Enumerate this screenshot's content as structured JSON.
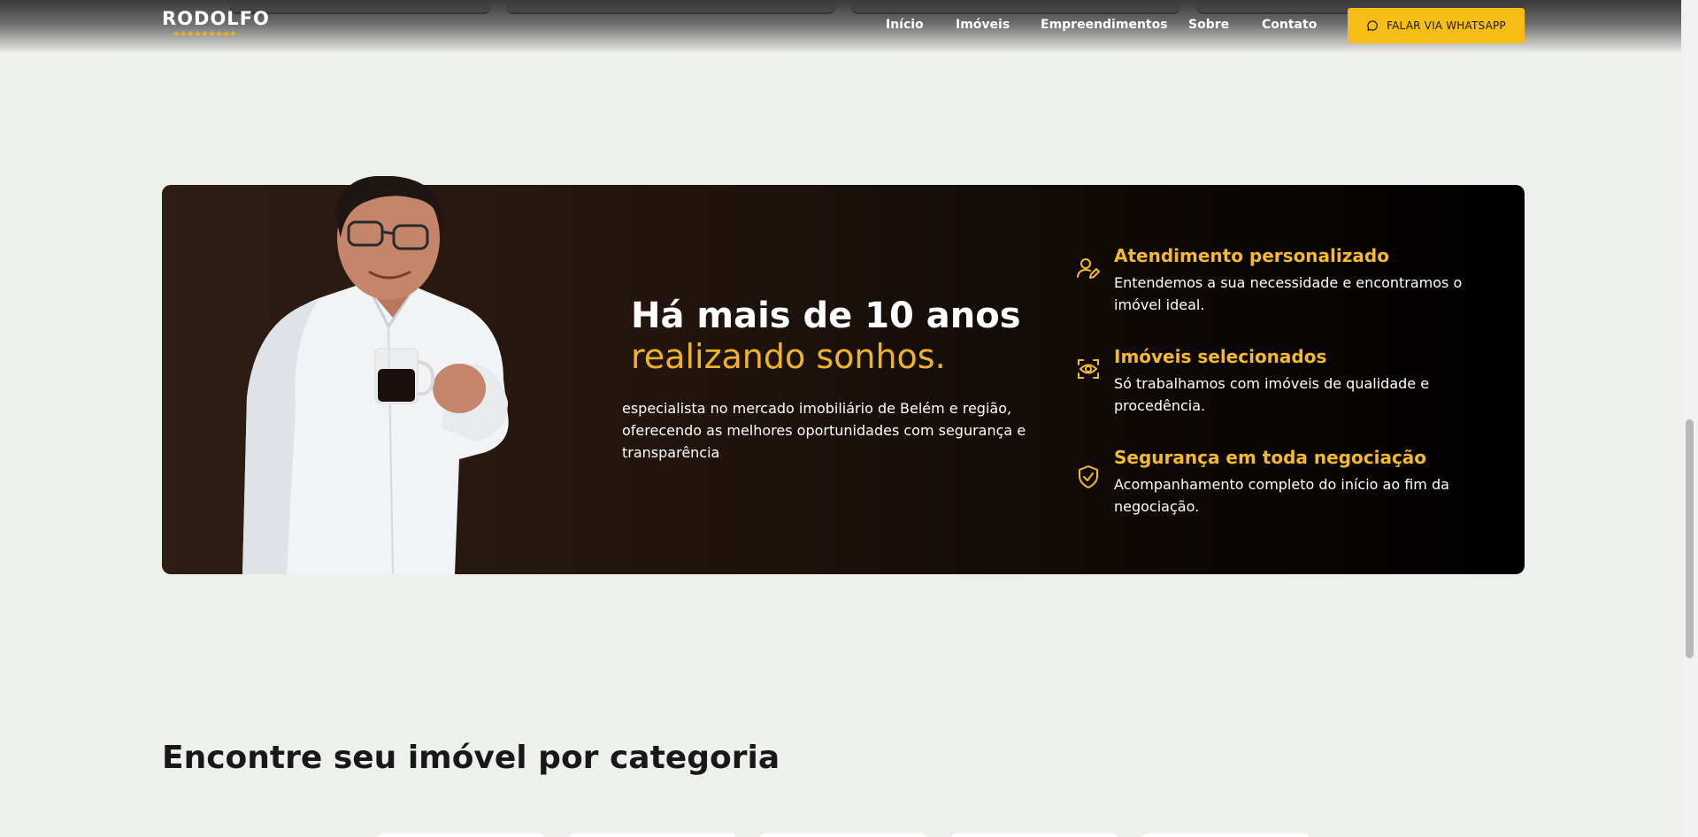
{
  "header": {
    "logo_text": "RODOLFO",
    "logo_stars": "★★★★★★★★★",
    "nav": [
      "Início",
      "Imóveis",
      "Empreendimentos",
      "Sobre",
      "Contato"
    ],
    "cta_label": "FALAR VIA WHATSAPP"
  },
  "banner": {
    "headline_line1": "Há mais de 10 anos",
    "headline_line2": "realizando sonhos.",
    "lead": "especialista no mercado imobiliário de Belém e região, oferecendo as melhores oportunidades com segurança e transparência",
    "features": [
      {
        "icon": "user-edit-icon",
        "title": "Atendimento personalizado",
        "description": "Entendemos a sua necessidade e encontramos o imóvel ideal."
      },
      {
        "icon": "eye-scan-icon",
        "title": "Imóveis selecionados",
        "description": "Só trabalhamos com imóveis de qualidade e procedência."
      },
      {
        "icon": "shield-check-icon",
        "title": "Segurança em toda negociação",
        "description": "Acompanhamento completo do início ao fim da negociação."
      }
    ]
  },
  "categories": {
    "title": "Encontre seu imóvel por categoria"
  },
  "colors": {
    "accent": "#f6bd16",
    "accent_text": "#f5b92b",
    "page_bg": "#eef0ec",
    "banner_dark": "#000000"
  }
}
